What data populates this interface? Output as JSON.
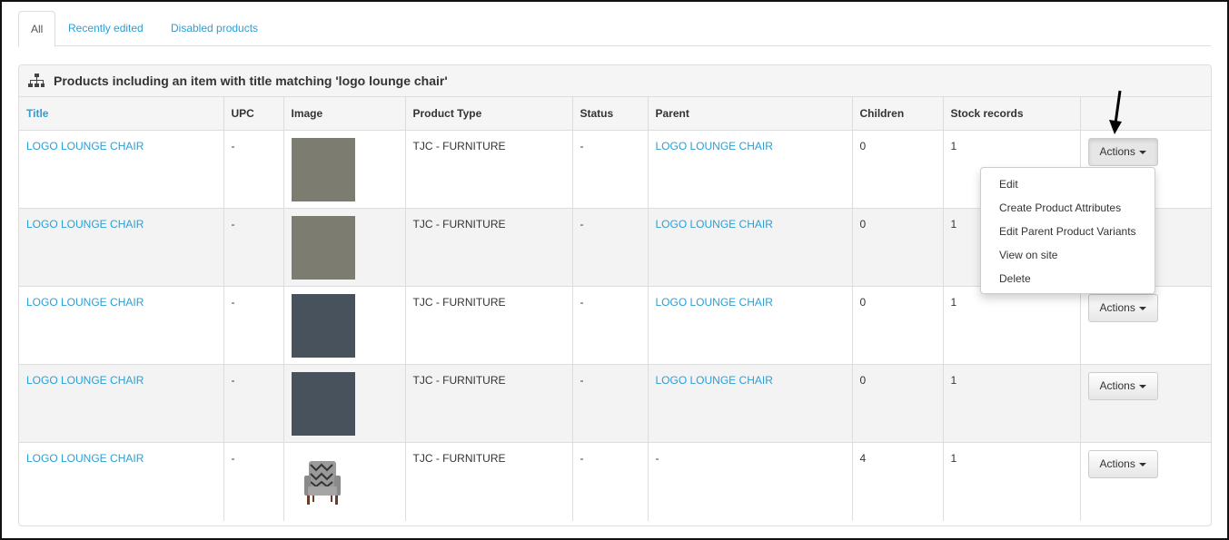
{
  "tabs": [
    {
      "label": "All",
      "active": true
    },
    {
      "label": "Recently edited",
      "active": false
    },
    {
      "label": "Disabled products",
      "active": false
    }
  ],
  "panel": {
    "heading": "Products including an item with title matching 'logo lounge chair'",
    "icon": "sitemap-icon"
  },
  "table": {
    "headers": [
      "Title",
      "UPC",
      "Image",
      "Product Type",
      "Status",
      "Parent",
      "Children",
      "Stock records",
      ""
    ],
    "rows": [
      {
        "title": "LOGO LOUNGE CHAIR",
        "upc": "-",
        "image": "swatch-taupe",
        "product_type": "TJC - FURNITURE",
        "status": "-",
        "parent": "LOGO LOUNGE CHAIR",
        "children": "0",
        "stock": "1",
        "action": "Actions"
      },
      {
        "title": "LOGO LOUNGE CHAIR",
        "upc": "-",
        "image": "swatch-taupe",
        "product_type": "TJC - FURNITURE",
        "status": "-",
        "parent": "LOGO LOUNGE CHAIR",
        "children": "0",
        "stock": "1",
        "action": "Actions"
      },
      {
        "title": "LOGO LOUNGE CHAIR",
        "upc": "-",
        "image": "swatch-slate",
        "product_type": "TJC - FURNITURE",
        "status": "-",
        "parent": "LOGO LOUNGE CHAIR",
        "children": "0",
        "stock": "1",
        "action": "Actions"
      },
      {
        "title": "LOGO LOUNGE CHAIR",
        "upc": "-",
        "image": "swatch-slate",
        "product_type": "TJC - FURNITURE",
        "status": "-",
        "parent": "LOGO LOUNGE CHAIR",
        "children": "0",
        "stock": "1",
        "action": "Actions"
      },
      {
        "title": "LOGO LOUNGE CHAIR",
        "upc": "-",
        "image": "chair-photo",
        "product_type": "TJC - FURNITURE",
        "status": "-",
        "parent": "-",
        "children": "4",
        "stock": "1",
        "action": "Actions"
      }
    ]
  },
  "dropdown": {
    "items": [
      "Edit",
      "Create Product Attributes",
      "Edit Parent Product Variants",
      "View on site",
      "Delete"
    ]
  },
  "colors": {
    "link": "#2a9fd6",
    "swatch_taupe": "#7d7c70",
    "swatch_slate": "#48525c"
  }
}
